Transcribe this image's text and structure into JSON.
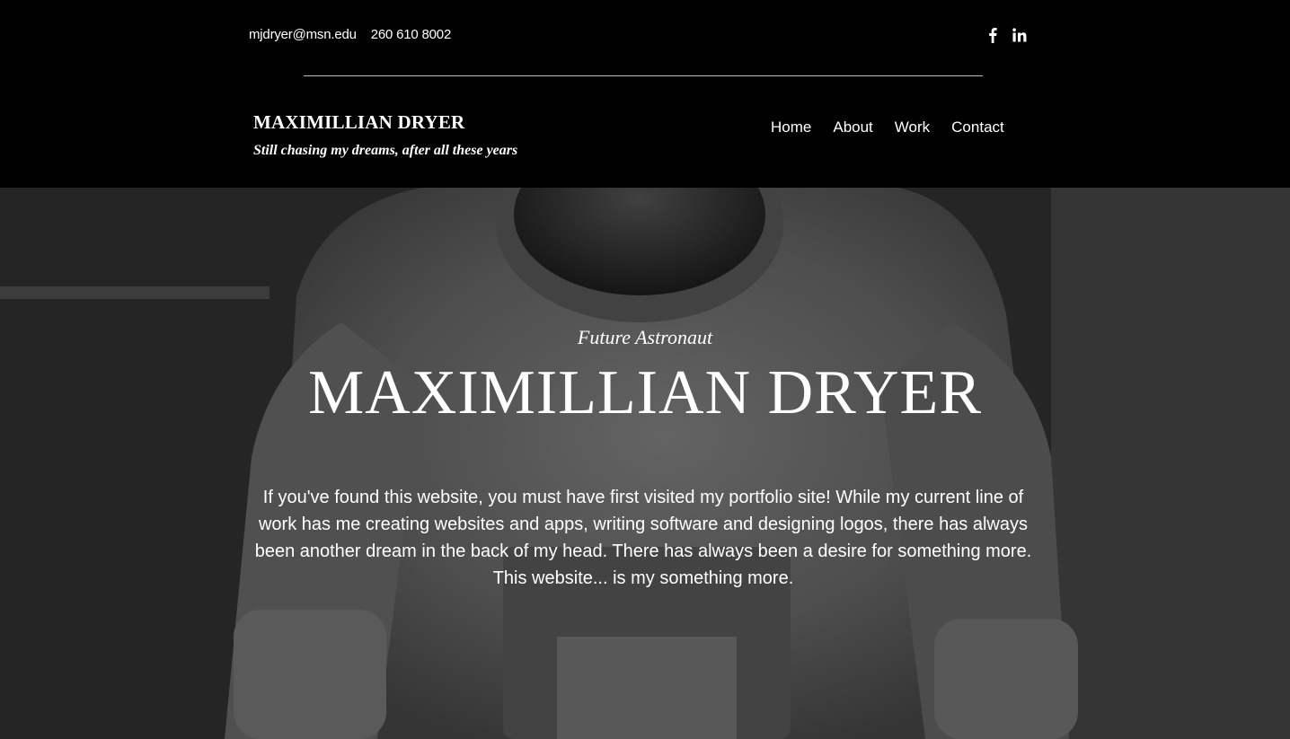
{
  "header": {
    "email": "mjdryer@msn.edu",
    "phone": "260 610 8002",
    "social": [
      {
        "icon": "facebook-icon",
        "glyph": "f"
      },
      {
        "icon": "linkedin-icon",
        "glyph": "in"
      }
    ],
    "site_name": "MAXIMILLIAN DRYER",
    "tagline": "Still chasing my dreams, after all these years",
    "nav": [
      "Home",
      "About",
      "Work",
      "Contact"
    ]
  },
  "hero": {
    "kicker": "Future Astronaut",
    "title": "MAXIMILLIAN DRYER",
    "paragraph": "If you've found this website, you must have first visited my portfolio site! While my current line of work has me creating websites and apps, writing software and designing logos, there has always been another dream in the back of my head. There has always been a desire for something more.",
    "closing": "This website... is my something more."
  },
  "colors": {
    "header_bg": "#000000",
    "text": "#ffffff",
    "divider": "#bdbdbd"
  }
}
